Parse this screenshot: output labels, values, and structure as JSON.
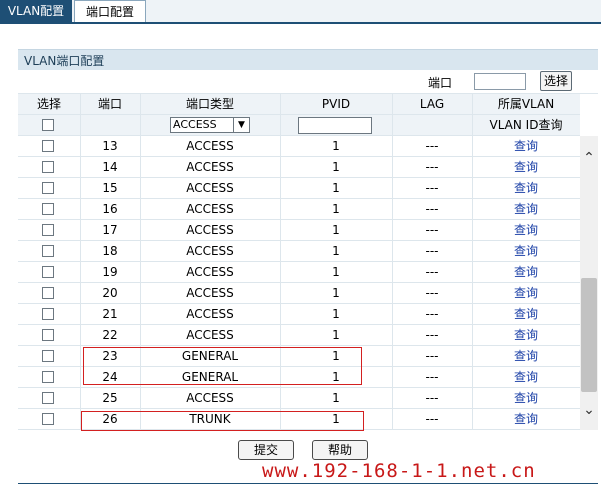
{
  "tabs": [
    {
      "label": "VLAN配置",
      "active": false
    },
    {
      "label": "端口配置",
      "active": true
    }
  ],
  "panel": {
    "title": "VLAN端口配置"
  },
  "port_search": {
    "label": "端口",
    "value": "",
    "button": "选择"
  },
  "headers": {
    "select": "选择",
    "port": "端口",
    "type": "端口类型",
    "pvid": "PVID",
    "lag": "LAG",
    "vlan": "所属VLAN"
  },
  "filter_row": {
    "type_value": "ACCESS",
    "pvid_value": "",
    "vlan_text": "VLAN ID查询"
  },
  "rows": [
    {
      "port": "13",
      "type": "ACCESS",
      "pvid": "1",
      "lag": "---",
      "action": "查询"
    },
    {
      "port": "14",
      "type": "ACCESS",
      "pvid": "1",
      "lag": "---",
      "action": "查询"
    },
    {
      "port": "15",
      "type": "ACCESS",
      "pvid": "1",
      "lag": "---",
      "action": "查询"
    },
    {
      "port": "16",
      "type": "ACCESS",
      "pvid": "1",
      "lag": "---",
      "action": "查询"
    },
    {
      "port": "17",
      "type": "ACCESS",
      "pvid": "1",
      "lag": "---",
      "action": "查询"
    },
    {
      "port": "18",
      "type": "ACCESS",
      "pvid": "1",
      "lag": "---",
      "action": "查询"
    },
    {
      "port": "19",
      "type": "ACCESS",
      "pvid": "1",
      "lag": "---",
      "action": "查询"
    },
    {
      "port": "20",
      "type": "ACCESS",
      "pvid": "1",
      "lag": "---",
      "action": "查询"
    },
    {
      "port": "21",
      "type": "ACCESS",
      "pvid": "1",
      "lag": "---",
      "action": "查询"
    },
    {
      "port": "22",
      "type": "ACCESS",
      "pvid": "1",
      "lag": "---",
      "action": "查询"
    },
    {
      "port": "23",
      "type": "GENERAL",
      "pvid": "1",
      "lag": "---",
      "action": "查询"
    },
    {
      "port": "24",
      "type": "GENERAL",
      "pvid": "1",
      "lag": "---",
      "action": "查询"
    },
    {
      "port": "25",
      "type": "ACCESS",
      "pvid": "1",
      "lag": "---",
      "action": "查询"
    },
    {
      "port": "26",
      "type": "TRUNK",
      "pvid": "1",
      "lag": "---",
      "action": "查询"
    }
  ],
  "buttons": {
    "submit": "提交",
    "help": "帮助"
  },
  "watermark": "www.192-168-1-1.net.cn",
  "colors": {
    "nav_dark": "#1e4f75",
    "header_bg": "#d9e6ef",
    "link": "#1a3fa6",
    "highlight": "#d32020"
  }
}
